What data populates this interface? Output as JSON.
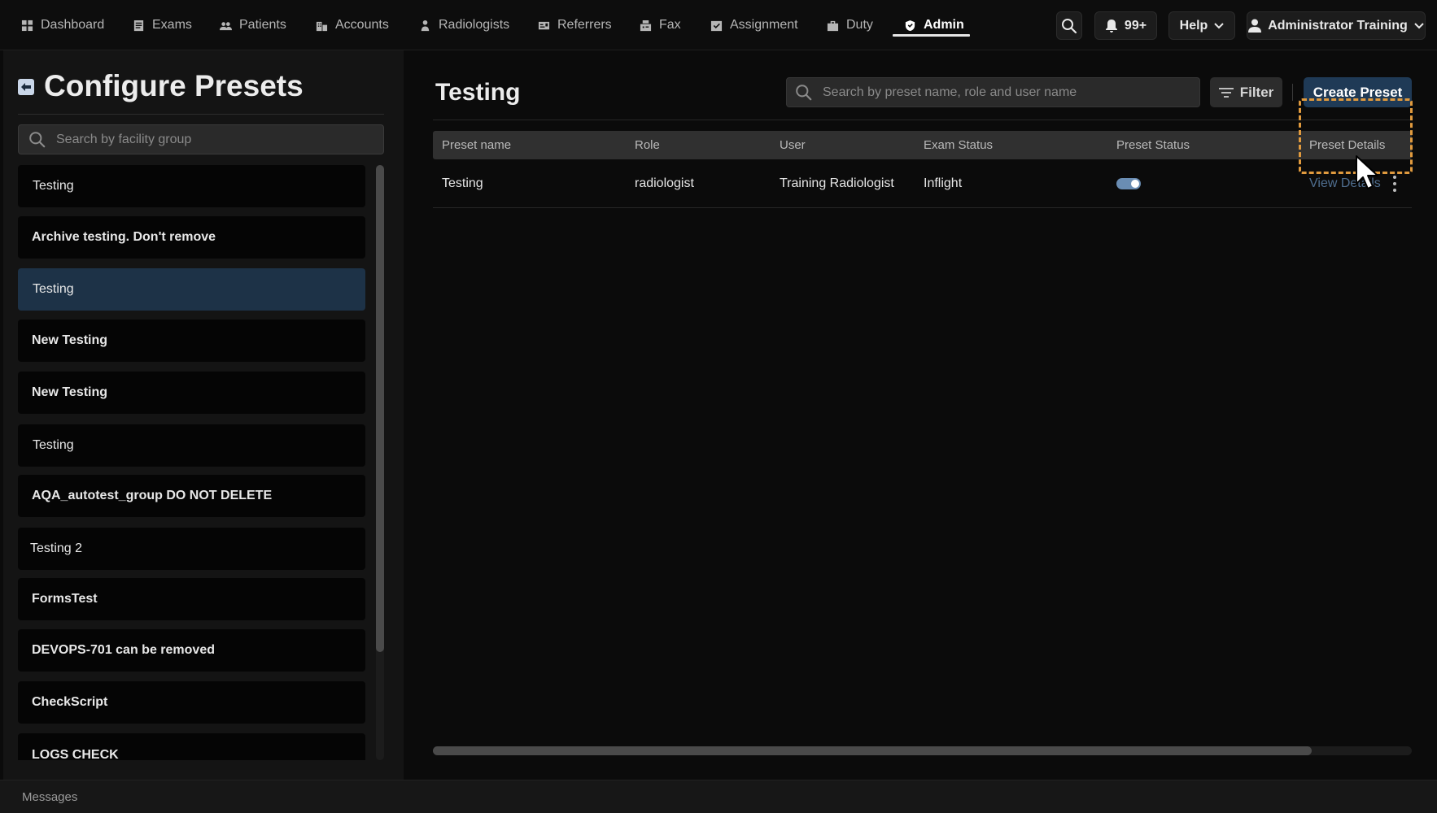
{
  "nav": {
    "items": [
      {
        "label": "Dashboard",
        "icon": "dashboard-icon"
      },
      {
        "label": "Exams",
        "icon": "exams-icon"
      },
      {
        "label": "Patients",
        "icon": "patients-icon"
      },
      {
        "label": "Accounts",
        "icon": "accounts-icon"
      },
      {
        "label": "Radiologists",
        "icon": "radiologist-icon"
      },
      {
        "label": "Referrers",
        "icon": "referrer-icon"
      },
      {
        "label": "Fax",
        "icon": "fax-icon"
      },
      {
        "label": "Assignment",
        "icon": "assignment-icon"
      },
      {
        "label": "Duty",
        "icon": "duty-icon"
      },
      {
        "label": "Admin",
        "icon": "admin-shield-icon",
        "active": true
      }
    ],
    "notifications_count": "99+",
    "help_label": "Help",
    "user_label": "Administrator Training"
  },
  "left_panel": {
    "title": "Configure Presets",
    "search_placeholder": "Search by facility group",
    "groups": [
      {
        "label": "Testing",
        "bold": false,
        "selected": false
      },
      {
        "label": "Archive testing. Don't remove",
        "bold": true,
        "selected": false
      },
      {
        "label": "Testing",
        "bold": false,
        "selected": true
      },
      {
        "label": "New Testing",
        "bold": true,
        "selected": false
      },
      {
        "label": "New Testing",
        "bold": true,
        "selected": false
      },
      {
        "label": "Testing",
        "bold": false,
        "selected": false
      },
      {
        "label": "AQA_autotest_group DO NOT DELETE",
        "bold": true,
        "selected": false
      },
      {
        "label": "Testing 2",
        "bold": false,
        "selected": false
      },
      {
        "label": "FormsTest",
        "bold": true,
        "selected": false
      },
      {
        "label": "DEVOPS-701 can be removed",
        "bold": true,
        "selected": false
      },
      {
        "label": "CheckScript",
        "bold": true,
        "selected": false
      },
      {
        "label": "LOGS CHECK",
        "bold": true,
        "selected": false
      }
    ]
  },
  "main": {
    "title": "Testing",
    "search_placeholder": "Search by preset name, role and user name",
    "filter_label": "Filter",
    "create_label": "Create Preset",
    "columns": [
      "Preset name",
      "Role",
      "User",
      "Exam Status",
      "Preset Status",
      "Preset Details"
    ],
    "rows": [
      {
        "preset_name": "Testing",
        "role": "radiologist",
        "user": "Training Radiologist",
        "exam_status": "Inflight",
        "preset_status_on": true,
        "details_label": "View Details"
      }
    ]
  },
  "footer": {
    "messages_label": "Messages"
  },
  "colors": {
    "accent": "#1f3a56",
    "selected_row": "#1d3247",
    "highlight": "#e09a3e"
  }
}
